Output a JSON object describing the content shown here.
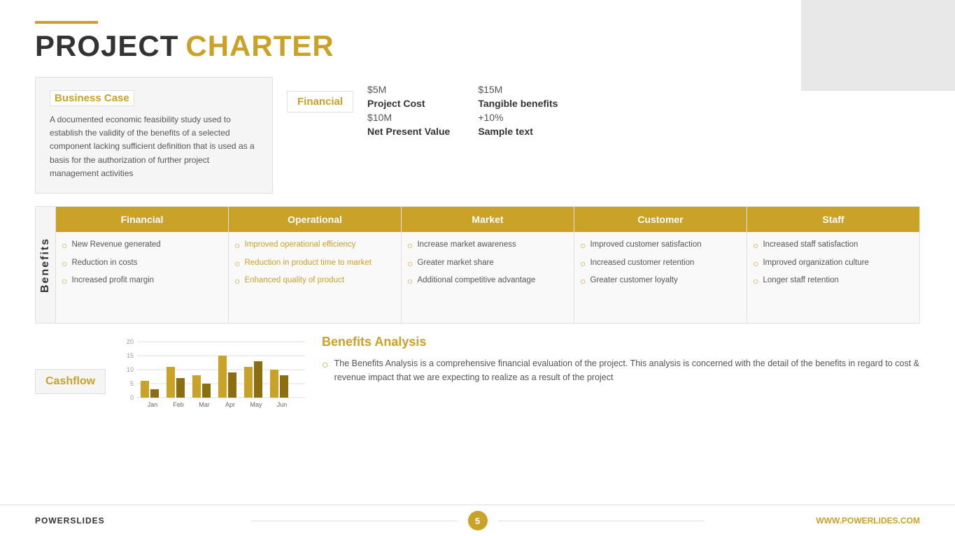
{
  "title": {
    "part1": "PROJECT",
    "part2": "CHARTER"
  },
  "business_case": {
    "label": "Business Case",
    "text": "A documented economic feasibility study used to establish the validity of the benefits of a selected component lacking sufficient definition that is used as a basis for the authorization of further project management activities"
  },
  "financial": {
    "label": "Financial",
    "items": [
      {
        "value": "$5M",
        "key": "Project Cost"
      },
      {
        "value": "$15M",
        "key": "Tangible benefits"
      },
      {
        "value": "$10M",
        "key": "Net Present Value"
      },
      {
        "value": "+10%",
        "key": "Sample text"
      }
    ]
  },
  "benefits": {
    "section_label": "Benefits",
    "columns": [
      {
        "header": "Financial",
        "items": [
          "New Revenue generated",
          "Reduction in costs",
          "Increased profit margin"
        ]
      },
      {
        "header": "Operational",
        "items": [
          "Improved operational efficiency",
          "Reduction in product time to market",
          "Enhanced quality of product"
        ]
      },
      {
        "header": "Market",
        "items": [
          "Increase market awareness",
          "Greater market share",
          "Additional competitive advantage"
        ]
      },
      {
        "header": "Customer",
        "items": [
          "Improved customer satisfaction",
          "Increased customer retention",
          "Greater customer loyalty"
        ]
      },
      {
        "header": "Staff",
        "items": [
          "Increased staff satisfaction",
          "Improved organization culture",
          "Longer staff retention"
        ]
      }
    ]
  },
  "cashflow": {
    "label": "Cashflow",
    "chart": {
      "y_labels": [
        "20",
        "15",
        "10",
        "5",
        "0"
      ],
      "bars": [
        {
          "month": "Jan",
          "val1": 6,
          "val2": 3
        },
        {
          "month": "Feb",
          "val1": 11,
          "val2": 7
        },
        {
          "month": "Mar",
          "val1": 8,
          "val2": 5
        },
        {
          "month": "Apr",
          "val1": 15,
          "val2": 9
        },
        {
          "month": "May",
          "val1": 11,
          "val2": 13
        },
        {
          "month": "Jun",
          "val1": 10,
          "val2": 8
        }
      ],
      "max": 20
    }
  },
  "benefits_analysis": {
    "title": "Benefits Analysis",
    "text": "The Benefits Analysis is a comprehensive financial evaluation of the project. This analysis is concerned with the detail of the benefits in regard to cost & revenue impact that we are expecting to realize as a result of the project"
  },
  "footer": {
    "left": "POWERSLIDES",
    "page": "5",
    "right": "WWW.POWERLIDES.COM"
  }
}
